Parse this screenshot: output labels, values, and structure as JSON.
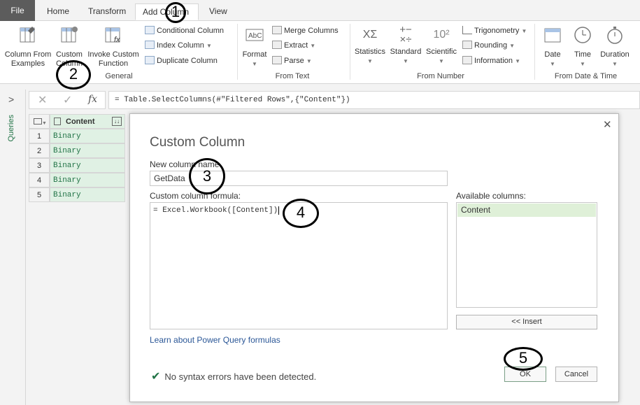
{
  "tabs": [
    {
      "label": "File"
    },
    {
      "label": "Home"
    },
    {
      "label": "Transform"
    },
    {
      "label": "Add Column"
    },
    {
      "label": "View"
    }
  ],
  "ribbon": {
    "general": {
      "label": "General",
      "column_from_examples": "Column From\nExamples",
      "custom_column": "Custom\nColumn",
      "invoke_custom_function": "Invoke Custom\nFunction",
      "conditional_column": "Conditional Column",
      "index_column": "Index Column",
      "duplicate_column": "Duplicate Column"
    },
    "from_text": {
      "label": "From Text",
      "format": "Format",
      "merge_columns": "Merge Columns",
      "extract": "Extract",
      "parse": "Parse"
    },
    "from_number": {
      "label": "From Number",
      "statistics": "Statistics",
      "standard": "Standard",
      "scientific": "Scientific",
      "trigonometry": "Trigonometry",
      "rounding": "Rounding",
      "information": "Information"
    },
    "from_date_time": {
      "label": "From Date & Time",
      "date": "Date",
      "time": "Time",
      "duration": "Duration"
    }
  },
  "queries_label": "Queries",
  "formula_bar": {
    "fx": "fx",
    "formula": "= Table.SelectColumns(#\"Filtered Rows\",{\"Content\"})"
  },
  "grid": {
    "header": "Content",
    "rows": [
      {
        "n": "1",
        "v": "Binary"
      },
      {
        "n": "2",
        "v": "Binary"
      },
      {
        "n": "3",
        "v": "Binary"
      },
      {
        "n": "4",
        "v": "Binary"
      },
      {
        "n": "5",
        "v": "Binary"
      }
    ]
  },
  "dialog": {
    "title": "Custom Column",
    "new_column_name_label": "New column name",
    "new_column_name_value": "GetData",
    "formula_label": "Custom column formula:",
    "formula_value": "= Excel.Workbook([Content])",
    "available_label": "Available columns:",
    "available_items": [
      "Content"
    ],
    "insert_button": "<< Insert",
    "learn_link": "Learn about Power Query formulas",
    "status": "No syntax errors have been detected.",
    "ok": "OK",
    "cancel": "Cancel"
  },
  "annotations": [
    "1",
    "2",
    "3",
    "4",
    "5"
  ],
  "colors": {
    "accent_green": "#217346",
    "file_tab": "#5c5c5c",
    "cell_green": "#e0f1e4"
  }
}
